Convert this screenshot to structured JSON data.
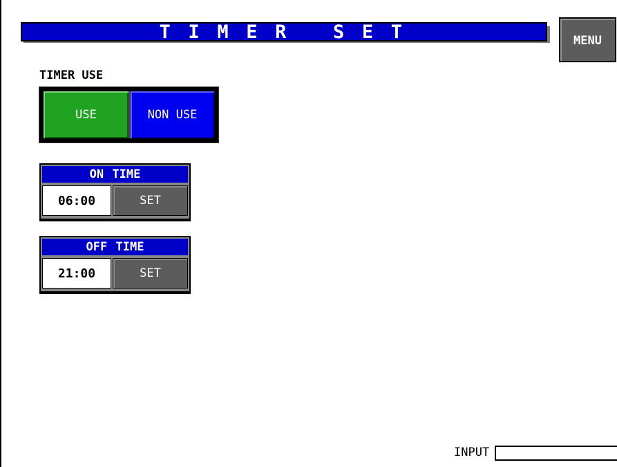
{
  "header": {
    "title": "TIMER SET",
    "menu_label": "MENU"
  },
  "timer_use": {
    "label": "TIMER USE",
    "options": [
      {
        "label": "USE",
        "color": "#1fa321",
        "selected": true
      },
      {
        "label": "NON USE",
        "color": "#0000f0",
        "selected": false
      }
    ]
  },
  "on_time": {
    "label": "ON TIME",
    "value": "06:00",
    "set_label": "SET"
  },
  "off_time": {
    "label": "OFF TIME",
    "value": "21:00",
    "set_label": "SET"
  },
  "input": {
    "label": "INPUT",
    "value": ""
  },
  "colors": {
    "header_blue": "#0000c8",
    "button_gray": "#5c5c5c"
  }
}
